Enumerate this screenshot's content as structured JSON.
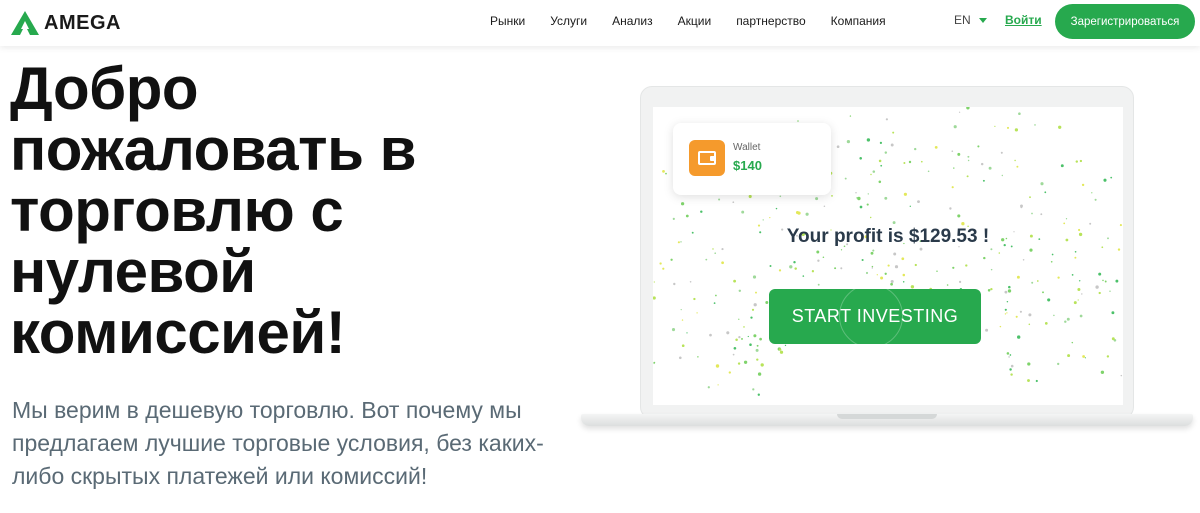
{
  "brand": {
    "name": "AMEGA",
    "color": "#27a94e"
  },
  "nav": {
    "items": [
      {
        "label": "Рынки"
      },
      {
        "label": "Услуги"
      },
      {
        "label": "Анализ"
      },
      {
        "label": "Акции"
      },
      {
        "label": "партнерство"
      },
      {
        "label": "Компания"
      }
    ],
    "language": "EN",
    "login_label": "Войти",
    "register_label": "Зарегистрироваться"
  },
  "hero": {
    "title": "Добро пожаловать в торговлю с нулевой комиссией!",
    "subtitle": "Мы верим в дешевую торговлю. Вот почему мы предлагаем лучшие торговые условия, без каких-либо скрытых платежей или комиссий!"
  },
  "laptop_screen": {
    "wallet": {
      "label": "Wallet",
      "value": "$140",
      "icon": "wallet-icon",
      "icon_color": "#f59a2c"
    },
    "profit_text": "Your profit is $129.53 !",
    "cta_label": "START INVESTING"
  }
}
